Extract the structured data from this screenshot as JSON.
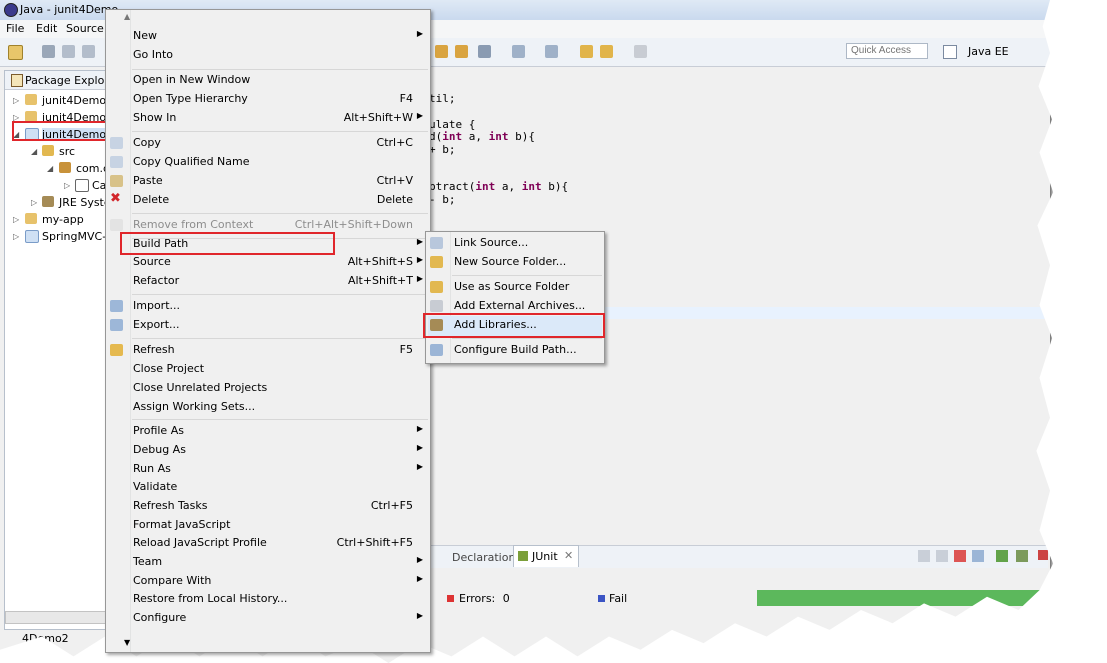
{
  "window": {
    "title": "Java - junit4Demo",
    "menu": [
      "File",
      "Edit",
      "Source"
    ],
    "quick_access_placeholder": "Quick Access",
    "perspective": "Java EE",
    "status_text": "4Demo2"
  },
  "package_explorer": {
    "title": "Package Explor",
    "items": [
      {
        "label": "junit4Demo",
        "twisty": "▷"
      },
      {
        "label": "junit4Demo1",
        "twisty": "▷"
      },
      {
        "label": "junit4Demo2",
        "twisty": "◢"
      },
      {
        "label": "src",
        "twisty": "◢"
      },
      {
        "label": "com.c",
        "twisty": "◢"
      },
      {
        "label": "Ca",
        "twisty": "▷"
      },
      {
        "label": "JRE Syste",
        "twisty": "▷"
      },
      {
        "label": "my-app",
        "twisty": "▷"
      },
      {
        "label": "SpringMVC-",
        "twisty": "▷"
      }
    ]
  },
  "editor": {
    "lines": [
      {
        "pre": "til;",
        "kw": "",
        "post": ""
      },
      {
        "pre": "ulate {",
        "kw": "",
        "post": ""
      },
      {
        "pre": "d(",
        "kw": "int",
        "post": " a, ",
        "kw2": "int",
        "post2": " b){"
      },
      {
        "pre": "+ b;",
        "kw": "",
        "post": ""
      },
      {
        "pre": "btract(",
        "kw": "int",
        "post": " a, ",
        "kw2": "int",
        "post2": " b){"
      },
      {
        "pre": "- b;",
        "kw": "",
        "post": ""
      }
    ]
  },
  "bottom_view": {
    "tabs": [
      "Declaration",
      "JUnit"
    ],
    "errors_label": "Errors:",
    "errors_value": "0",
    "failures_label": "Fail"
  },
  "context_menu": {
    "items": [
      {
        "label": "New",
        "accel": "",
        "submenu": true
      },
      {
        "label": "Go Into",
        "accel": ""
      },
      {
        "label": "Open in New Window",
        "accel": ""
      },
      {
        "label": "Open Type Hierarchy",
        "accel": "F4"
      },
      {
        "label": "Show In",
        "accel": "Alt+Shift+W",
        "submenu": true
      },
      {
        "label": "Copy",
        "accel": "Ctrl+C"
      },
      {
        "label": "Copy Qualified Name",
        "accel": ""
      },
      {
        "label": "Paste",
        "accel": "Ctrl+V"
      },
      {
        "label": "Delete",
        "accel": "Delete"
      },
      {
        "label": "Remove from Context",
        "accel": "Ctrl+Alt+Shift+Down",
        "disabled": true
      },
      {
        "label": "Build Path",
        "accel": "",
        "submenu": true
      },
      {
        "label": "Source",
        "accel": "Alt+Shift+S",
        "submenu": true
      },
      {
        "label": "Refactor",
        "accel": "Alt+Shift+T",
        "submenu": true
      },
      {
        "label": "Import...",
        "accel": ""
      },
      {
        "label": "Export...",
        "accel": ""
      },
      {
        "label": "Refresh",
        "accel": "F5"
      },
      {
        "label": "Close Project",
        "accel": ""
      },
      {
        "label": "Close Unrelated Projects",
        "accel": ""
      },
      {
        "label": "Assign Working Sets...",
        "accel": ""
      },
      {
        "label": "Profile As",
        "accel": "",
        "submenu": true
      },
      {
        "label": "Debug As",
        "accel": "",
        "submenu": true
      },
      {
        "label": "Run As",
        "accel": "",
        "submenu": true
      },
      {
        "label": "Validate",
        "accel": ""
      },
      {
        "label": "Refresh Tasks",
        "accel": "Ctrl+F5"
      },
      {
        "label": "Format JavaScript",
        "accel": ""
      },
      {
        "label": "Reload JavaScript Profile",
        "accel": "Ctrl+Shift+F5"
      },
      {
        "label": "Team",
        "accel": "",
        "submenu": true
      },
      {
        "label": "Compare With",
        "accel": "",
        "submenu": true
      },
      {
        "label": "Restore from Local History...",
        "accel": ""
      },
      {
        "label": "Configure",
        "accel": "",
        "submenu": true
      }
    ]
  },
  "build_path_submenu": {
    "items": [
      {
        "label": "Link Source..."
      },
      {
        "label": "New Source Folder..."
      },
      {
        "label": "Use as Source Folder"
      },
      {
        "label": "Add External Archives..."
      },
      {
        "label": "Add Libraries..."
      },
      {
        "label": "Configure Build Path..."
      }
    ]
  },
  "colors": {
    "highlight_box": "#e0262b",
    "junit_bar": "#5cb85c",
    "keyword": "#7f0055"
  }
}
